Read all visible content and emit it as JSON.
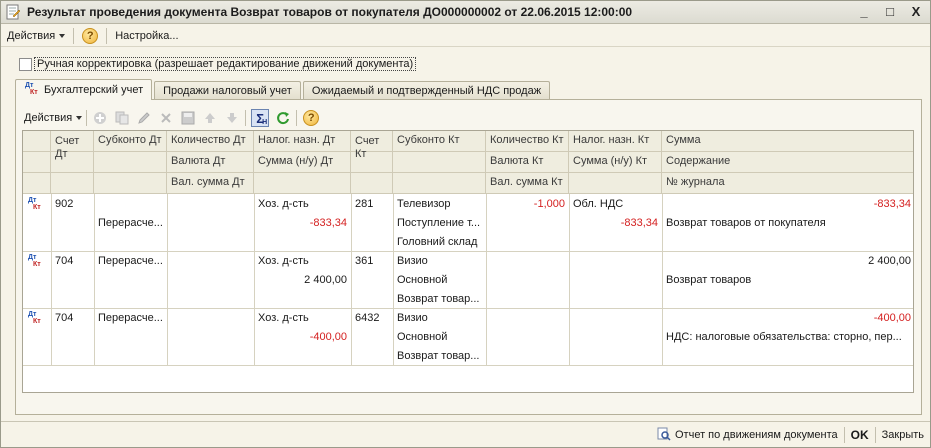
{
  "window": {
    "title": "Результат проведения документа Возврат товаров от покупателя ДО000000002 от 22.06.2015 12:00:00",
    "controls": [
      "_",
      "□",
      "X"
    ]
  },
  "toolbar": {
    "actions_label": "Действия",
    "settings_label": "Настройка..."
  },
  "manual_check": {
    "label": "Ручная корректировка (разрешает редактирование движений документа)",
    "checked": false
  },
  "tabs": [
    {
      "label": "Бухгалтерский учет",
      "active": true
    },
    {
      "label": "Продажи налоговый учет",
      "active": false
    },
    {
      "label": "Ожидаемый и подтвержденный НДС продаж",
      "active": false
    }
  ],
  "panel_toolbar": {
    "actions_label": "Действия",
    "sigma": "Σ",
    "sigma_sub": "H"
  },
  "columns": {
    "row1": [
      "Счет Дт",
      "Субконто Дт",
      "Количество Дт",
      "Налог. назн. Дт",
      "Счет Кт",
      "Субконто Кт",
      "Количество Кт",
      "Налог. назн. Кт",
      "Сумма"
    ],
    "row2": [
      "Валюта Дт",
      "Сумма (н/у) Дт",
      "Валюта Кт",
      "Сумма (н/у) Кт",
      "Содержание"
    ],
    "row3": [
      "Вал. сумма Дт",
      "Вал. сумма Кт",
      "№ журнала"
    ]
  },
  "records": [
    {
      "acc_dt": "902",
      "sub_dt": [
        "",
        "Перерасче...",
        ""
      ],
      "qty_dt": [
        "",
        "",
        ""
      ],
      "tax_dt": "Хоз. д-сть",
      "sum_nu_dt": "-833,34",
      "acc_kt": "281",
      "sub_kt": [
        "Телевизор",
        "Поступление т...",
        "Головний склад"
      ],
      "qty_kt": "-1,000",
      "tax_kt": "Обл. НДС",
      "sum_nu_kt": "-833,34",
      "sum": "-833,34",
      "content": "Возврат товаров от покупателя"
    },
    {
      "acc_dt": "704",
      "sub_dt": [
        "Перерасче...",
        "",
        ""
      ],
      "qty_dt": [
        "",
        "",
        ""
      ],
      "tax_dt": "Хоз. д-сть",
      "sum_nu_dt": "2 400,00",
      "acc_kt": "361",
      "sub_kt": [
        "Визио",
        "Основной",
        "Возврат товар..."
      ],
      "qty_kt": "",
      "tax_kt": "",
      "sum_nu_kt": "",
      "sum": "2 400,00",
      "content": "Возврат товаров"
    },
    {
      "acc_dt": "704",
      "sub_dt": [
        "Перерасче...",
        "",
        ""
      ],
      "qty_dt": [
        "",
        "",
        ""
      ],
      "tax_dt": "Хоз. д-сть",
      "sum_nu_dt": "-400,00",
      "acc_kt": "6432",
      "sub_kt": [
        "Визио",
        "Основной",
        "Возврат товар..."
      ],
      "qty_kt": "",
      "tax_kt": "",
      "sum_nu_kt": "",
      "sum": "-400,00",
      "content": "НДС: налоговые обязательства: сторно, пер..."
    }
  ],
  "statusbar": {
    "report_label": "Отчет по движениям документа",
    "ok_label": "OK",
    "close_label": "Закрыть"
  },
  "colors": {
    "negative": "#d42020",
    "header_bg": "#efeddf",
    "window_bg": "#f6f3e8"
  }
}
